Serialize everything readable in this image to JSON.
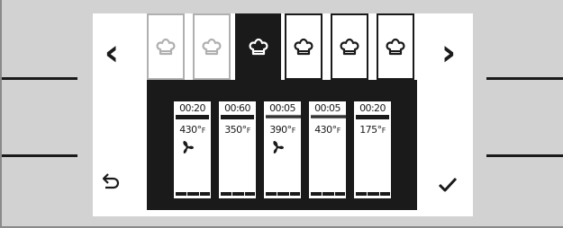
{
  "nav": {
    "prev_label": "‹",
    "next_label": "›",
    "back_icon": "back-arrow-icon",
    "confirm_icon": "check-icon"
  },
  "tabs": [
    {
      "icon": "chef-hat-icon",
      "state": "faded"
    },
    {
      "icon": "chef-hat-icon",
      "state": "faded"
    },
    {
      "icon": "chef-hat-icon",
      "state": "selected"
    },
    {
      "icon": "chef-hat-icon",
      "state": "normal"
    },
    {
      "icon": "chef-hat-icon",
      "state": "normal"
    },
    {
      "icon": "chef-hat-icon",
      "state": "normal"
    }
  ],
  "steps": [
    {
      "time": "00:20",
      "temp": "430°",
      "unit": "F",
      "heating": "bar",
      "fan": true
    },
    {
      "time": "00:60",
      "temp": "350°",
      "unit": "F",
      "heating": "bar",
      "fan": false
    },
    {
      "time": "00:05",
      "temp": "390°",
      "unit": "F",
      "heating": "wave",
      "fan": true
    },
    {
      "time": "00:05",
      "temp": "430°",
      "unit": "F",
      "heating": "wave",
      "fan": false
    },
    {
      "time": "00:20",
      "temp": "175°",
      "unit": "F",
      "heating": "bar",
      "fan": false
    }
  ],
  "colors": {
    "ink": "#1a1a1a",
    "screen": "#ffffff",
    "bezel": "#d2d2d2",
    "faded": "#b0b0b0"
  }
}
